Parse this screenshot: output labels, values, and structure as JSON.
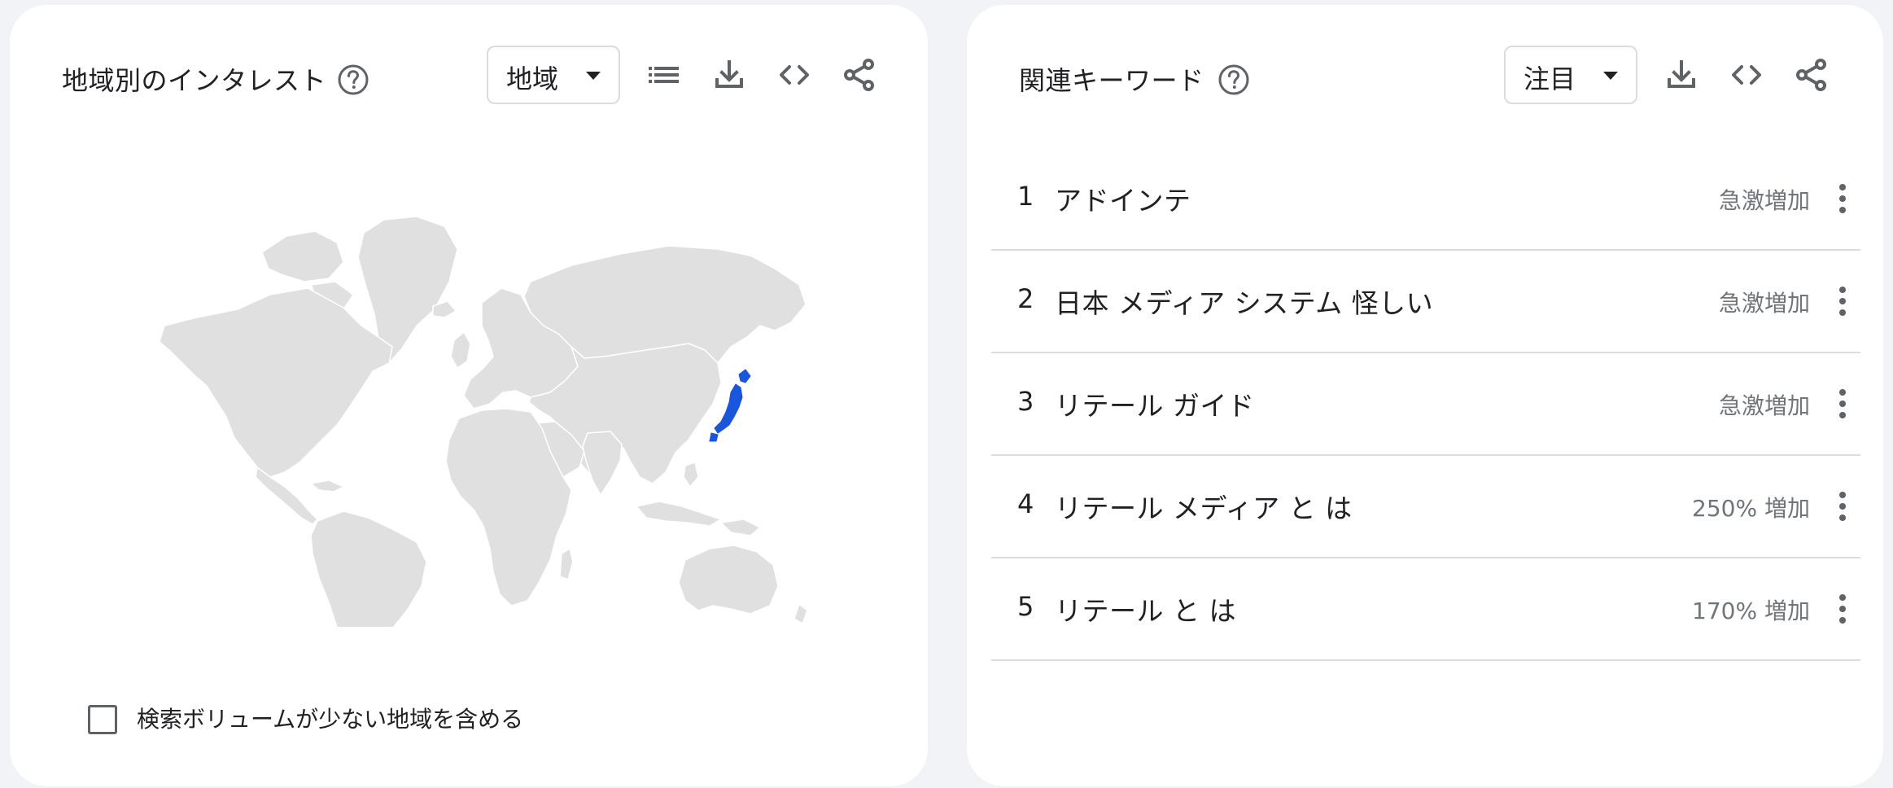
{
  "left_card": {
    "title": "地域別のインタレスト",
    "dropdown_label": "地域",
    "include_low_volume_label": "検索ボリュームが少ない地域を含める",
    "include_low_volume_checked": false,
    "highlight_color": "#1a56db",
    "land_color": "#e0e0e0"
  },
  "right_card": {
    "title": "関連キーワード",
    "dropdown_label": "注目",
    "items": [
      {
        "rank": "1",
        "term": "アドインテ",
        "value": "急激増加"
      },
      {
        "rank": "2",
        "term": "日本 メディア システム 怪しい",
        "value": "急激増加"
      },
      {
        "rank": "3",
        "term": "リテール ガイド",
        "value": "急激増加"
      },
      {
        "rank": "4",
        "term": "リテール メディア と は",
        "value": "250% 増加"
      },
      {
        "rank": "5",
        "term": "リテール と は",
        "value": "170% 増加"
      }
    ]
  },
  "icons": {
    "help": "help-circle-icon",
    "list": "list-icon",
    "download": "download-icon",
    "embed": "code-embed-icon",
    "share": "share-icon",
    "more": "more-vertical-icon",
    "caret": "caret-down-icon"
  }
}
